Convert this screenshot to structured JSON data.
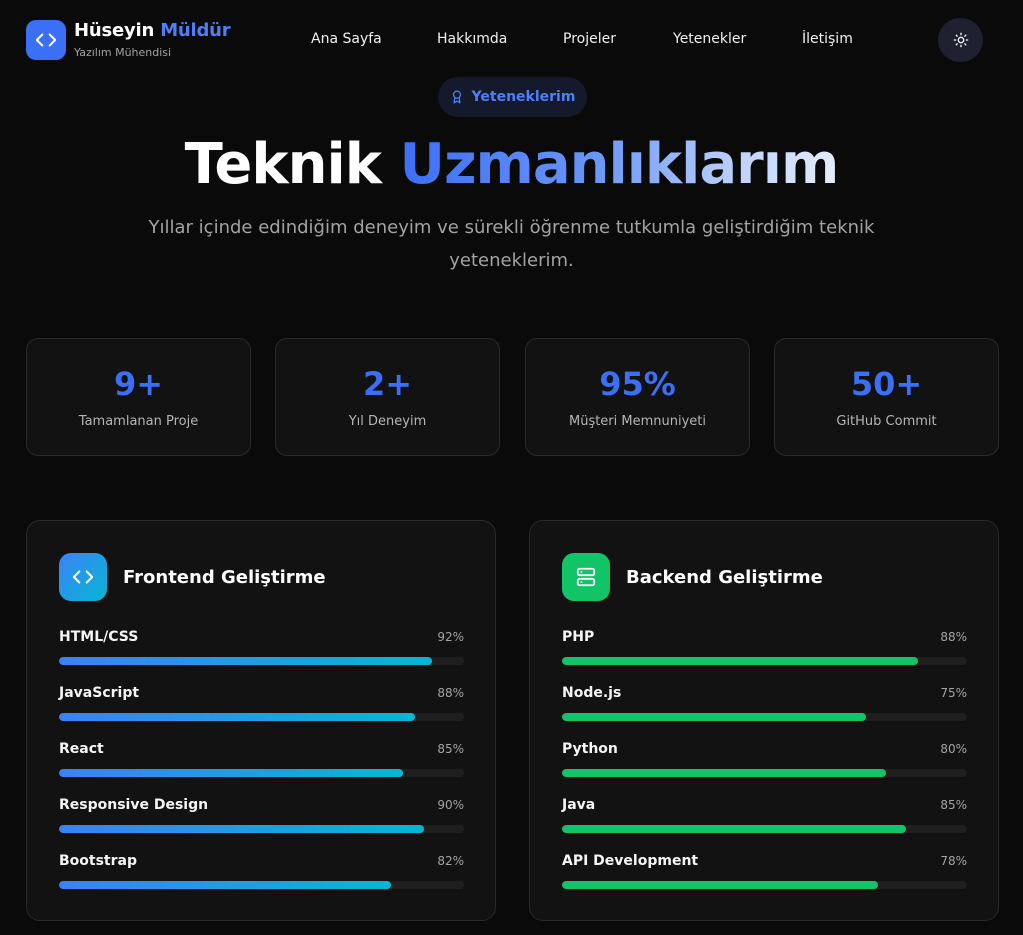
{
  "brand": {
    "first_name": "Hüseyin",
    "last_name": "Müldür",
    "subtitle": "Yazılım Mühendisi",
    "logo_icon": "code-icon",
    "accent_color": "#3b6ff6"
  },
  "nav": {
    "links": [
      "Ana Sayfa",
      "Hakkımda",
      "Projeler",
      "Yetenekler",
      "İletişim"
    ],
    "theme_toggle_icon": "sun-icon"
  },
  "hero": {
    "badge_icon": "award-icon",
    "badge_label": "Yeteneklerim",
    "title_plain": "Teknik",
    "title_accent": "Uzmanlıklarım",
    "description": "Yıllar içinde edindiğim deneyim ve sürekli öğrenme tutkumla geliştirdiğim teknik yeteneklerim."
  },
  "stats": [
    {
      "value": "9+",
      "label": "Tamamlanan Proje"
    },
    {
      "value": "2+",
      "label": "Yıl Deneyim"
    },
    {
      "value": "95%",
      "label": "Müşteri Memnuniyeti"
    },
    {
      "value": "50+",
      "label": "GitHub Commit"
    }
  ],
  "cards": [
    {
      "title": "Frontend Geliştirme",
      "icon": "code-icon",
      "color": "blue",
      "skills": [
        {
          "name": "HTML/CSS",
          "percent_label": "92%",
          "level": 92
        },
        {
          "name": "JavaScript",
          "percent_label": "88%",
          "level": 88
        },
        {
          "name": "React",
          "percent_label": "85%",
          "level": 85
        },
        {
          "name": "Responsive Design",
          "percent_label": "90%",
          "level": 90
        },
        {
          "name": "Bootstrap",
          "percent_label": "82%",
          "level": 82
        }
      ]
    },
    {
      "title": "Backend Geliştirme",
      "icon": "server-icon",
      "color": "green",
      "skills": [
        {
          "name": "PHP",
          "percent_label": "88%",
          "level": 88
        },
        {
          "name": "Node.js",
          "percent_label": "75%",
          "level": 75
        },
        {
          "name": "Python",
          "percent_label": "80%",
          "level": 80
        },
        {
          "name": "Java",
          "percent_label": "85%",
          "level": 85
        },
        {
          "name": "API Development",
          "percent_label": "78%",
          "level": 78
        }
      ]
    }
  ]
}
